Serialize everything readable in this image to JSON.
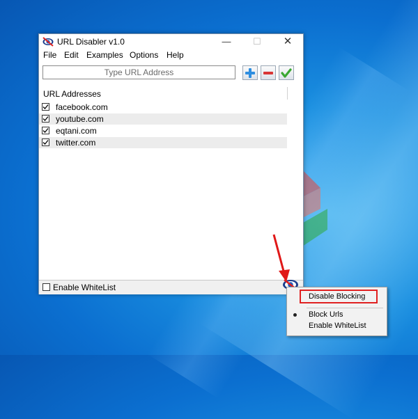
{
  "window": {
    "title": "URL Disabler v1.0",
    "minimize_glyph": "—",
    "maximize_glyph": "☐",
    "close_glyph": "✕"
  },
  "menu": [
    "File",
    "Edit",
    "Examples",
    "Options",
    "Help"
  ],
  "url_input": {
    "placeholder": "Type URL Address",
    "value": ""
  },
  "toolbar": {
    "add_icon": "plus-icon",
    "remove_icon": "minus-icon",
    "confirm_icon": "checkmark-icon"
  },
  "list": {
    "header": "URL Addresses",
    "items": [
      {
        "label": "facebook.com",
        "checked": true
      },
      {
        "label": "youtube.com",
        "checked": true
      },
      {
        "label": "eqtani.com",
        "checked": true
      },
      {
        "label": "twitter.com",
        "checked": true
      }
    ]
  },
  "status": {
    "whitelist_label": "Enable WhiteList",
    "whitelist_checked": false
  },
  "tray_menu": {
    "items": [
      {
        "label": "Disable Blocking",
        "highlighted": true
      },
      {
        "label": "Block Urls",
        "selected": true
      },
      {
        "label": "Enable WhiteList",
        "selected": false
      }
    ]
  },
  "colors": {
    "accent_blue": "#1a8fe0",
    "highlight_red": "#e02020",
    "add_button": "#2e8ee0",
    "remove_button": "#d93636",
    "confirm_button": "#3aa832"
  }
}
